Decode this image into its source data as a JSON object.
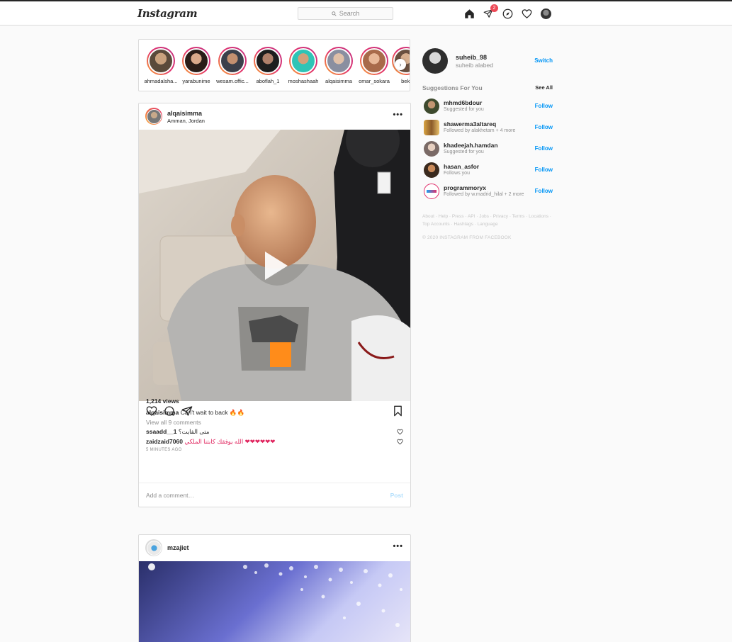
{
  "nav": {
    "logo": "Instagram",
    "search_placeholder": "Search",
    "inbox_badge": "2"
  },
  "stories": [
    {
      "name": "ahmadalsha..."
    },
    {
      "name": "yarabunime"
    },
    {
      "name": "wesam.offic..."
    },
    {
      "name": "aboflah_1"
    },
    {
      "name": "moshashaah"
    },
    {
      "name": "alqaisimma"
    },
    {
      "name": "omar_sokara"
    },
    {
      "name": "beki"
    }
  ],
  "post1": {
    "user": "alqaisimma",
    "location": "Amman, Jordan",
    "views": "1,214 views",
    "caption_user": "alqaisimma",
    "caption_text": "Can't wait to back 🔥🔥",
    "view_all": "View all 9 comments",
    "comments": [
      {
        "user": "ssaadd__1",
        "text": "متى الفايت؟"
      },
      {
        "user": "zaidzaid7060",
        "text": "الله يوفقك كابتنا الملكي ❤❤❤❤❤❤"
      }
    ],
    "time": "5 MINUTES AGO",
    "comment_placeholder": "Add a comment…",
    "post_button": "Post"
  },
  "post2": {
    "user": "mzajiet"
  },
  "sidebar": {
    "username": "suheib_98",
    "fullname": "suheib alabed",
    "switch": "Switch",
    "suggestions_title": "Suggestions For You",
    "see_all": "See All",
    "suggestions": [
      {
        "user": "mhmd6bdour",
        "sub": "Suggested for you",
        "follow": "Follow"
      },
      {
        "user": "shawerma3altareq",
        "sub": "Followed by alakhetam + 4 more",
        "follow": "Follow"
      },
      {
        "user": "khadeejah.hamdan",
        "sub": "Suggested for you",
        "follow": "Follow"
      },
      {
        "user": "hasan_asfor",
        "sub": "Follows you",
        "follow": "Follow"
      },
      {
        "user": "programmoryx",
        "sub": "Followed by w.madrid_hilal + 2 more",
        "follow": "Follow"
      }
    ],
    "footer": "About · Help · Press · API · Jobs · Privacy · Terms · Locations · Top Accounts · Hashtags · Language",
    "copyright": "© 2020 INSTAGRAM FROM FACEBOOK"
  }
}
